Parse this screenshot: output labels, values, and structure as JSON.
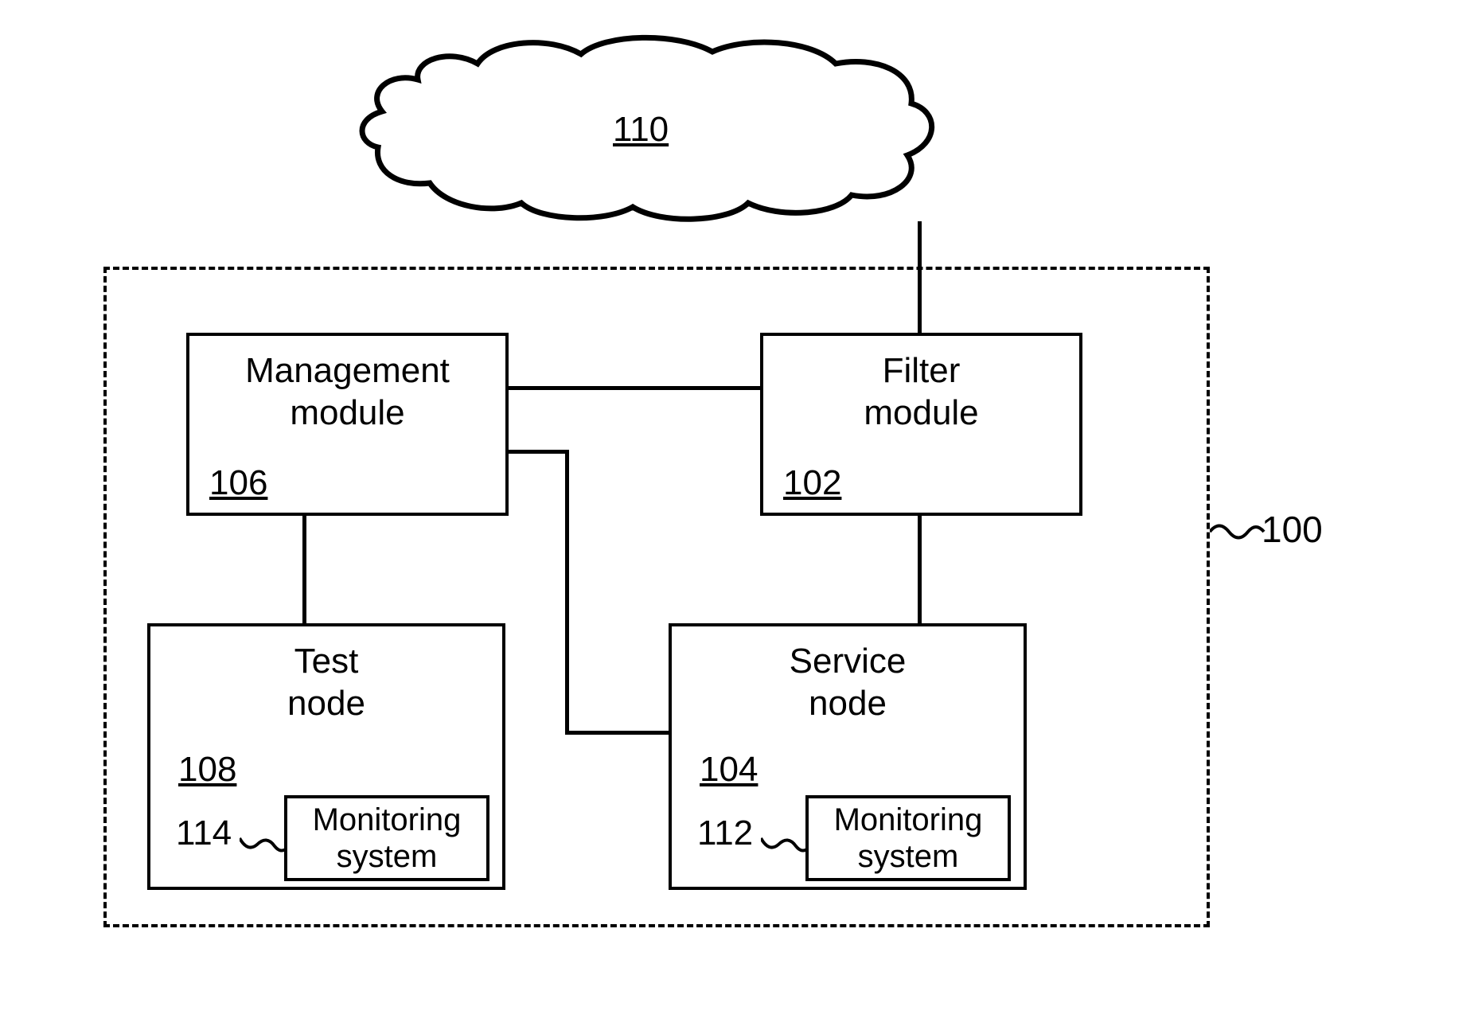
{
  "cloud": {
    "number": "110"
  },
  "system": {
    "label": "100"
  },
  "management": {
    "title_line1": "Management",
    "title_line2": "module",
    "number": "106"
  },
  "filter": {
    "title_line1": "Filter",
    "title_line2": "module",
    "number": "102"
  },
  "test": {
    "title_line1": "Test",
    "title_line2": "node",
    "number": "108",
    "monitoring_label": "114",
    "monitoring_line1": "Monitoring",
    "monitoring_line2": "system"
  },
  "service": {
    "title_line1": "Service",
    "title_line2": "node",
    "number": "104",
    "monitoring_label": "112",
    "monitoring_line1": "Monitoring",
    "monitoring_line2": "system"
  }
}
